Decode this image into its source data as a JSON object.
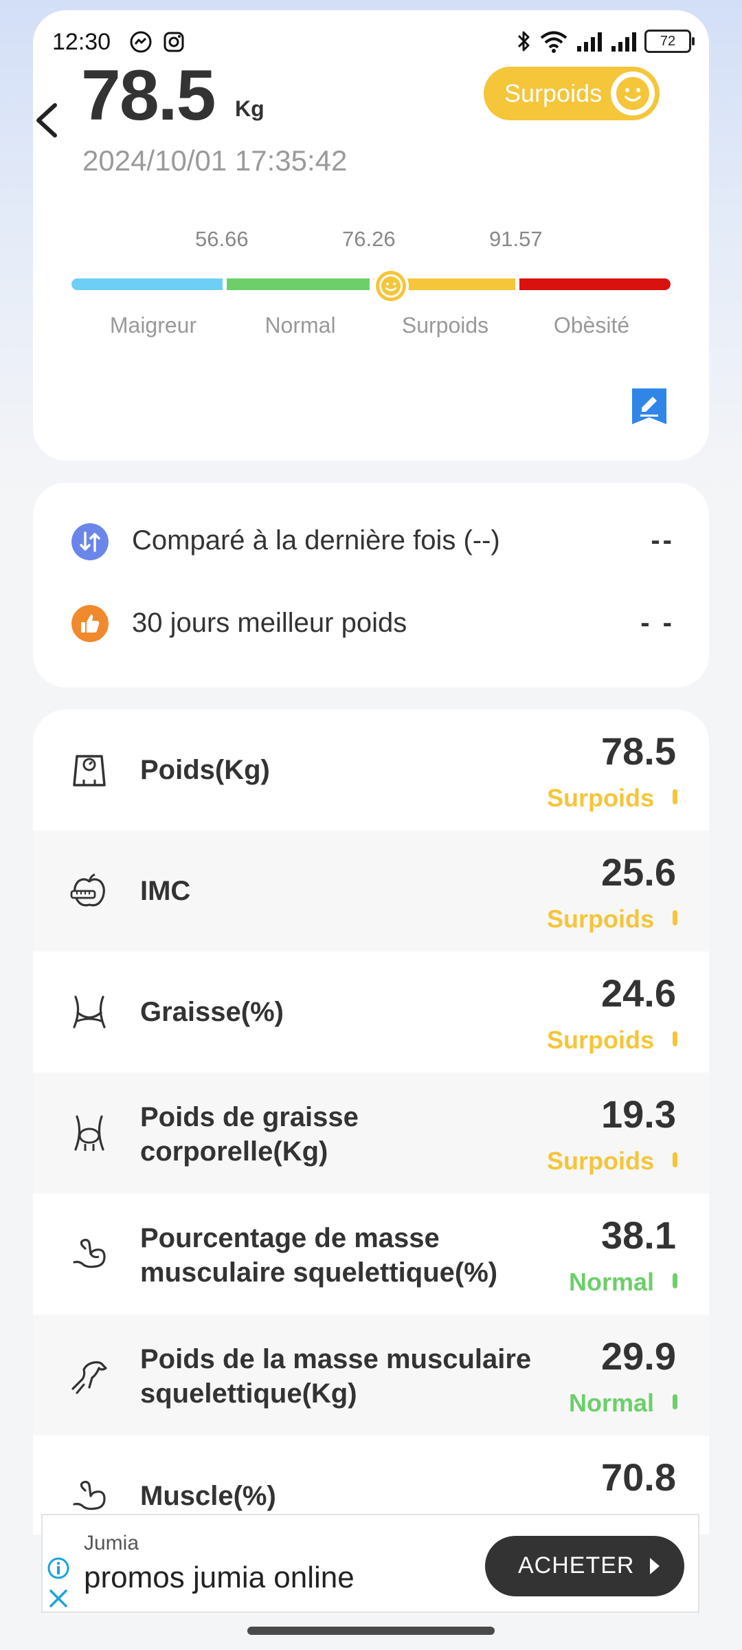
{
  "status_bar": {
    "time": "12:30",
    "app_icons": [
      "messenger-icon",
      "instagram-icon"
    ],
    "right_icons": [
      "bluetooth-icon",
      "wifi-icon",
      "signal-icon",
      "signal-icon"
    ],
    "battery": "72"
  },
  "summary": {
    "weight": "78.5",
    "unit": "Kg",
    "datetime": "2024/10/01 17:35:42",
    "status": "Surpoids",
    "status_color": "#f5c53a"
  },
  "scale": {
    "thresholds": [
      "56.66",
      "76.26",
      "91.57"
    ],
    "categories": [
      "Maigreur",
      "Normal",
      "Surpoids",
      "Obèsité"
    ],
    "colors": [
      "#6dcff6",
      "#6ccf6a",
      "#f5c53a",
      "#d9120f"
    ],
    "marker_position_fraction": 0.53
  },
  "compare": {
    "items": [
      {
        "icon": "compare-arrows-icon",
        "label": "Comparé à la dernière fois (--)",
        "value": "--"
      },
      {
        "icon": "thumbs-up-icon",
        "label": "30 jours meilleur poids",
        "value": "- -"
      }
    ]
  },
  "metrics": [
    {
      "icon": "scale-icon",
      "name": "Poids(Kg)",
      "value": "78.5",
      "status": "Surpoids"
    },
    {
      "icon": "apple-tape-icon",
      "name": "IMC",
      "value": "25.6",
      "status": "Surpoids"
    },
    {
      "icon": "waist-icon",
      "name": "Graisse(%)",
      "value": "24.6",
      "status": "Surpoids"
    },
    {
      "icon": "body-fat-icon",
      "name": "Poids de graisse corporelle(Kg)",
      "value": "19.3",
      "status": "Surpoids"
    },
    {
      "icon": "bicep-icon",
      "name": "Pourcentage de masse musculaire squelettique(%)",
      "value": "38.1",
      "status": "Normal"
    },
    {
      "icon": "running-leg-icon",
      "name": "Poids de la masse musculaire squelettique(Kg)",
      "value": "29.9",
      "status": "Normal"
    },
    {
      "icon": "bicep-icon",
      "name": "Muscle(%)",
      "value": "70.8",
      "status": ""
    }
  ],
  "status_colors": {
    "Surpoids": "#f5c53a",
    "Normal": "#6ccf6a"
  },
  "ad": {
    "brand": "Jumia",
    "title": "promos jumia online",
    "cta": "ACHETER"
  }
}
